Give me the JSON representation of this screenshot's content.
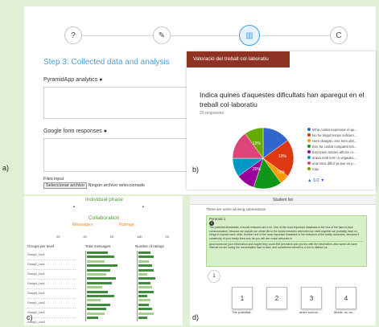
{
  "panel_a": {
    "label": "a)",
    "steps": [
      "?",
      "✎",
      "▥",
      "C"
    ],
    "title": "Step 3: Collected data and analysis",
    "analytics_label": "PyramidApp analytics",
    "responses_label": "Google form responses",
    "files_label": "Files input",
    "file_button": "Seleccionar archivo",
    "file_status": "Ningún archivo seleccionado"
  },
  "panel_b": {
    "label": "b)",
    "header": "Valoració del treball col·laboratiu",
    "question": "Indica quines d'aquestes dificultats han aparegut en el treball col·laboratiu",
    "responses": "20 responses",
    "pager": "1/2",
    "legend": [
      {
        "label": "M'ha costat expressar el qu...",
        "color": "#3366cc"
      },
      {
        "label": "No he tingut temps suficien...",
        "color": "#dc3912"
      },
      {
        "label": "Hem divagat i ens hem disl...",
        "color": "#ff9900"
      },
      {
        "label": "Ens ha costat compartir les...",
        "color": "#109618"
      },
      {
        "label": "Escriviem tots/es alhora i e...",
        "color": "#990099"
      },
      {
        "label": "arava molt lent i a vegades...",
        "color": "#0099c6"
      },
      {
        "label": "una mica difícil ja que es p...",
        "color": "#dd4477"
      },
      {
        "label": "Cap",
        "color": "#66aa00"
      }
    ],
    "pie_labels": [
      "15%",
      "10%",
      "20%",
      "15%"
    ],
    "pie_colors": [
      "#3366cc",
      "#dc3912",
      "#ff9900",
      "#109618",
      "#990099",
      "#0099c6",
      "#dd4477",
      "#66aa00"
    ],
    "pie_values": [
      15,
      20,
      5,
      15,
      10,
      10,
      15,
      10
    ]
  },
  "panel_c": {
    "label": "c)",
    "individual_phase": "Individual phase",
    "collaboration": "Collaboration",
    "messages": "Messages",
    "ratings": "Ratings",
    "groups_per_level": "Groups per level",
    "total_messages": "Total messages",
    "number_of_ratings": "Number of ratings",
    "stat_values": [
      "20",
      "20",
      "20",
      "180",
      "20"
    ],
    "groups": [
      "Group1_Lev1",
      "Group2_Lev1",
      "Group3_Lev1",
      "Group4_Lev1",
      "Group5_Lev1",
      "Group1_Lev2",
      "Group2_Lev2",
      "Group1_Lev3"
    ],
    "student_bars": [
      0.55,
      0.7,
      0.45,
      0.8,
      0.6,
      0.5,
      0.75,
      0.65,
      0.4,
      0.55,
      0.7,
      0.35,
      0.6,
      0.5,
      0.45,
      0.3
    ],
    "rating_bars": [
      0.4,
      0.5,
      0.35,
      0.45,
      0.5,
      0.3,
      0.55,
      0.4,
      0.45,
      0.5,
      0.3,
      0.4,
      0.35,
      0.45,
      0.5,
      0.3
    ]
  },
  "panel_d": {
    "label": "d)",
    "header": "Student list",
    "notice": "There are some winning submissions",
    "pyramid": "Pyramid 1",
    "answer_num": "5",
    "answer_text": "The potential drawbacks of social networks are a lot. One of the most important drawback is the loss of the face-to-face communication, because we explain our whole life to the social networks and when we meet together we probably have no things to explain each other. Another one of the most important drawback is the reduction of the family closeness, because if somebody of your family lives very far you will use social networks to",
    "answer_text2": "good someone your information and maybe they could feel pervasive and you too with the information, also some we have internet we are losing the conversation face to face, and sometimes internet is a box to distract us.",
    "page": "1",
    "cards": [
      "1",
      "2",
      "3",
      "4"
    ],
    "card_captions": [
      "The potential...",
      "",
      "amex somon...",
      "Modis .ou ca..."
    ]
  }
}
